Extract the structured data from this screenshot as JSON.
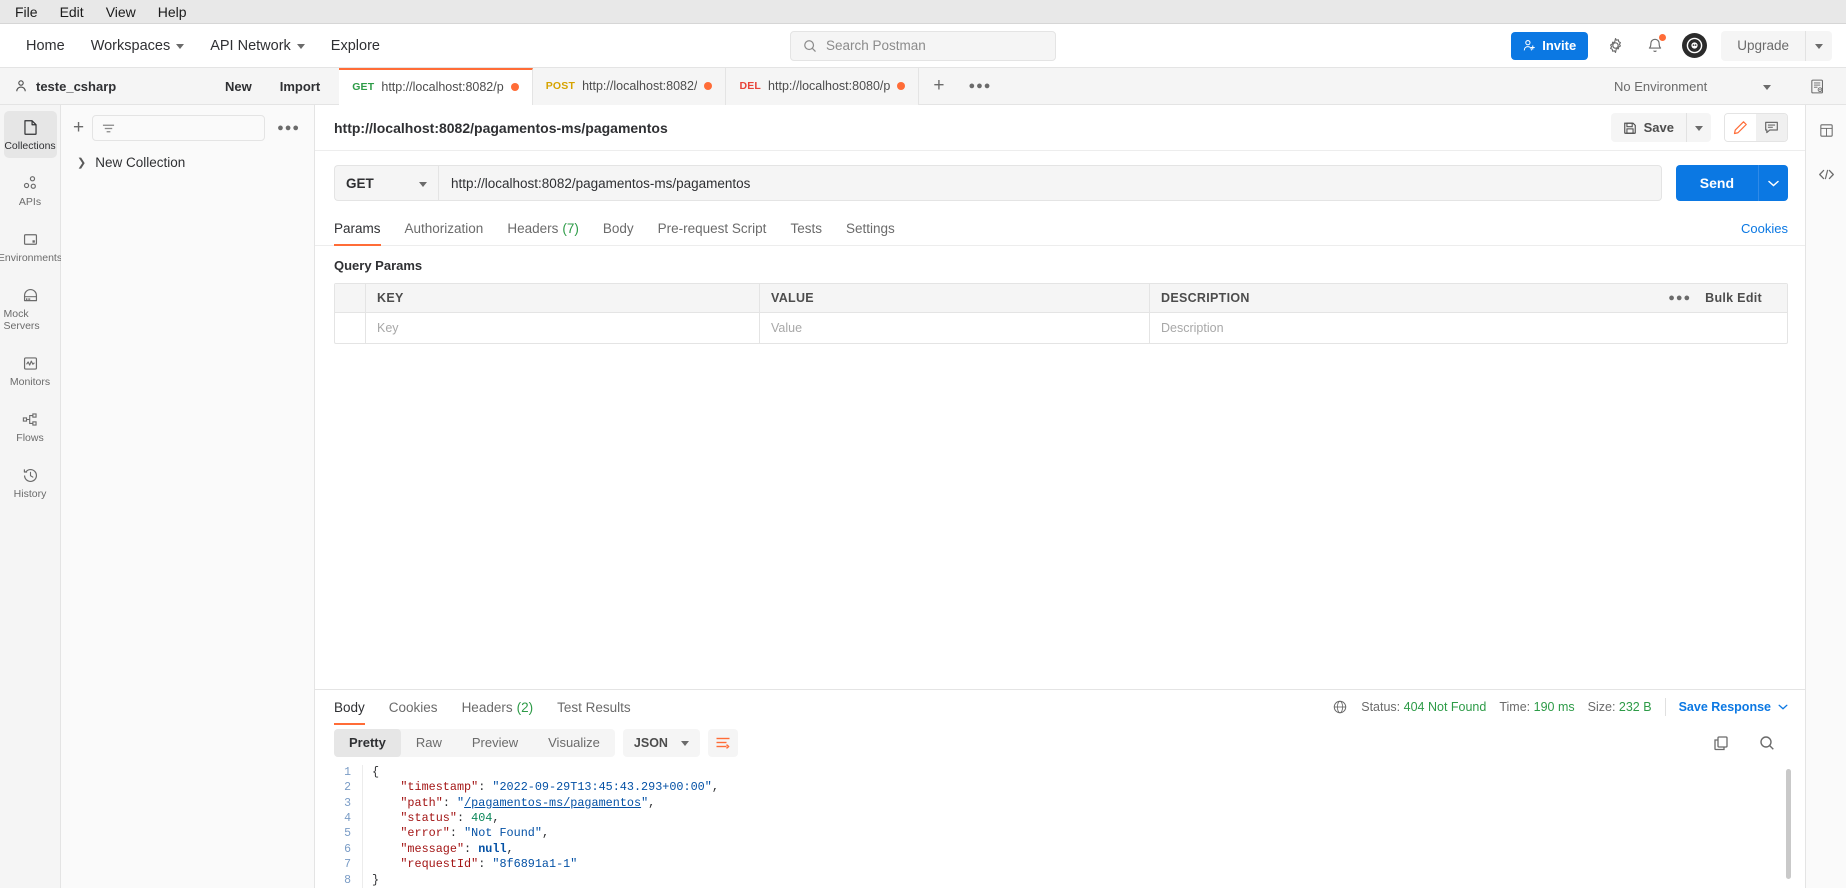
{
  "os_menu": [
    "File",
    "Edit",
    "View",
    "Help"
  ],
  "topnav": {
    "items": [
      {
        "label": "Home",
        "caret": false
      },
      {
        "label": "Workspaces",
        "caret": true
      },
      {
        "label": "API Network",
        "caret": true
      },
      {
        "label": "Explore",
        "caret": false
      }
    ],
    "search_placeholder": "Search Postman",
    "invite_label": "Invite",
    "upgrade_label": "Upgrade"
  },
  "workspace": {
    "name": "teste_csharp",
    "new_label": "New",
    "import_label": "Import",
    "environment_selected": "No Environment"
  },
  "tabs": [
    {
      "method": "GET",
      "method_class": "get",
      "name": "http://localhost:8082/p",
      "active": true,
      "unsaved": true
    },
    {
      "method": "POST",
      "method_class": "post",
      "name": "http://localhost:8082/",
      "active": false,
      "unsaved": true
    },
    {
      "method": "DEL",
      "method_class": "del",
      "name": "http://localhost:8080/p",
      "active": false,
      "unsaved": true
    }
  ],
  "rail": [
    {
      "label": "Collections",
      "icon": "collections-icon",
      "active": true
    },
    {
      "label": "APIs",
      "icon": "apis-icon",
      "active": false
    },
    {
      "label": "Environments",
      "icon": "environments-icon",
      "active": false
    },
    {
      "label": "Mock Servers",
      "icon": "mock-servers-icon",
      "active": false
    },
    {
      "label": "Monitors",
      "icon": "monitors-icon",
      "active": false
    },
    {
      "label": "Flows",
      "icon": "flows-icon",
      "active": false
    },
    {
      "label": "History",
      "icon": "history-icon",
      "active": false
    }
  ],
  "sidebar": {
    "filter_placeholder": "",
    "collections": [
      {
        "label": "New Collection"
      }
    ]
  },
  "request": {
    "title": "http://localhost:8082/pagamentos-ms/pagamentos",
    "save_label": "Save",
    "method": "GET",
    "url": "http://localhost:8082/pagamentos-ms/pagamentos",
    "send_label": "Send",
    "cookies_label": "Cookies",
    "tabs": [
      {
        "label": "Params",
        "count": "",
        "active": true
      },
      {
        "label": "Authorization",
        "count": "",
        "active": false
      },
      {
        "label": "Headers",
        "count": "(7)",
        "active": false
      },
      {
        "label": "Body",
        "count": "",
        "active": false
      },
      {
        "label": "Pre-request Script",
        "count": "",
        "active": false
      },
      {
        "label": "Tests",
        "count": "",
        "active": false
      },
      {
        "label": "Settings",
        "count": "",
        "active": false
      }
    ]
  },
  "query_params": {
    "section_label": "Query Params",
    "columns": [
      "KEY",
      "VALUE",
      "DESCRIPTION"
    ],
    "bulk_edit_label": "Bulk Edit",
    "rows": [
      {
        "key": "Key",
        "value": "Value",
        "description": "Description"
      }
    ]
  },
  "response": {
    "tabs": [
      {
        "label": "Body",
        "count": "",
        "active": true
      },
      {
        "label": "Cookies",
        "count": "",
        "active": false
      },
      {
        "label": "Headers",
        "count": "(2)",
        "active": false
      },
      {
        "label": "Test Results",
        "count": "",
        "active": false
      }
    ],
    "status_label": "Status:",
    "status_value": "404 Not Found",
    "time_label": "Time:",
    "time_value": "190 ms",
    "size_label": "Size:",
    "size_value": "232 B",
    "save_response_label": "Save Response",
    "format_tabs": [
      {
        "label": "Pretty",
        "active": true
      },
      {
        "label": "Raw",
        "active": false
      },
      {
        "label": "Preview",
        "active": false
      },
      {
        "label": "Visualize",
        "active": false
      }
    ],
    "language": "JSON",
    "body_lines": [
      {
        "n": "1",
        "tokens": [
          {
            "t": "{",
            "c": "p"
          }
        ]
      },
      {
        "n": "2",
        "tokens": [
          {
            "t": "    ",
            "c": "p"
          },
          {
            "t": "\"timestamp\"",
            "c": "k"
          },
          {
            "t": ": ",
            "c": "p"
          },
          {
            "t": "\"2022-09-29T13:45:43.293+00:00\"",
            "c": "s"
          },
          {
            "t": ",",
            "c": "p"
          }
        ]
      },
      {
        "n": "3",
        "tokens": [
          {
            "t": "    ",
            "c": "p"
          },
          {
            "t": "\"path\"",
            "c": "k"
          },
          {
            "t": ": ",
            "c": "p"
          },
          {
            "t": "\"",
            "c": "s"
          },
          {
            "t": "/pagamentos-ms/pagamentos",
            "c": "lnk"
          },
          {
            "t": "\"",
            "c": "s"
          },
          {
            "t": ",",
            "c": "p"
          }
        ]
      },
      {
        "n": "4",
        "tokens": [
          {
            "t": "    ",
            "c": "p"
          },
          {
            "t": "\"status\"",
            "c": "k"
          },
          {
            "t": ": ",
            "c": "p"
          },
          {
            "t": "404",
            "c": "n"
          },
          {
            "t": ",",
            "c": "p"
          }
        ]
      },
      {
        "n": "5",
        "tokens": [
          {
            "t": "    ",
            "c": "p"
          },
          {
            "t": "\"error\"",
            "c": "k"
          },
          {
            "t": ": ",
            "c": "p"
          },
          {
            "t": "\"Not Found\"",
            "c": "s"
          },
          {
            "t": ",",
            "c": "p"
          }
        ]
      },
      {
        "n": "6",
        "tokens": [
          {
            "t": "    ",
            "c": "p"
          },
          {
            "t": "\"message\"",
            "c": "k"
          },
          {
            "t": ": ",
            "c": "p"
          },
          {
            "t": "null",
            "c": "nul"
          },
          {
            "t": ",",
            "c": "p"
          }
        ]
      },
      {
        "n": "7",
        "tokens": [
          {
            "t": "    ",
            "c": "p"
          },
          {
            "t": "\"requestId\"",
            "c": "k"
          },
          {
            "t": ": ",
            "c": "p"
          },
          {
            "t": "\"8f6891a1-1\"",
            "c": "s"
          }
        ]
      },
      {
        "n": "8",
        "tokens": [
          {
            "t": "}",
            "c": "p"
          }
        ]
      }
    ]
  },
  "colors": {
    "accent": "#ff6c37",
    "primary": "#0b78e3",
    "success": "#2d9b47",
    "danger": "#e8443a",
    "warning": "#d6a300"
  }
}
